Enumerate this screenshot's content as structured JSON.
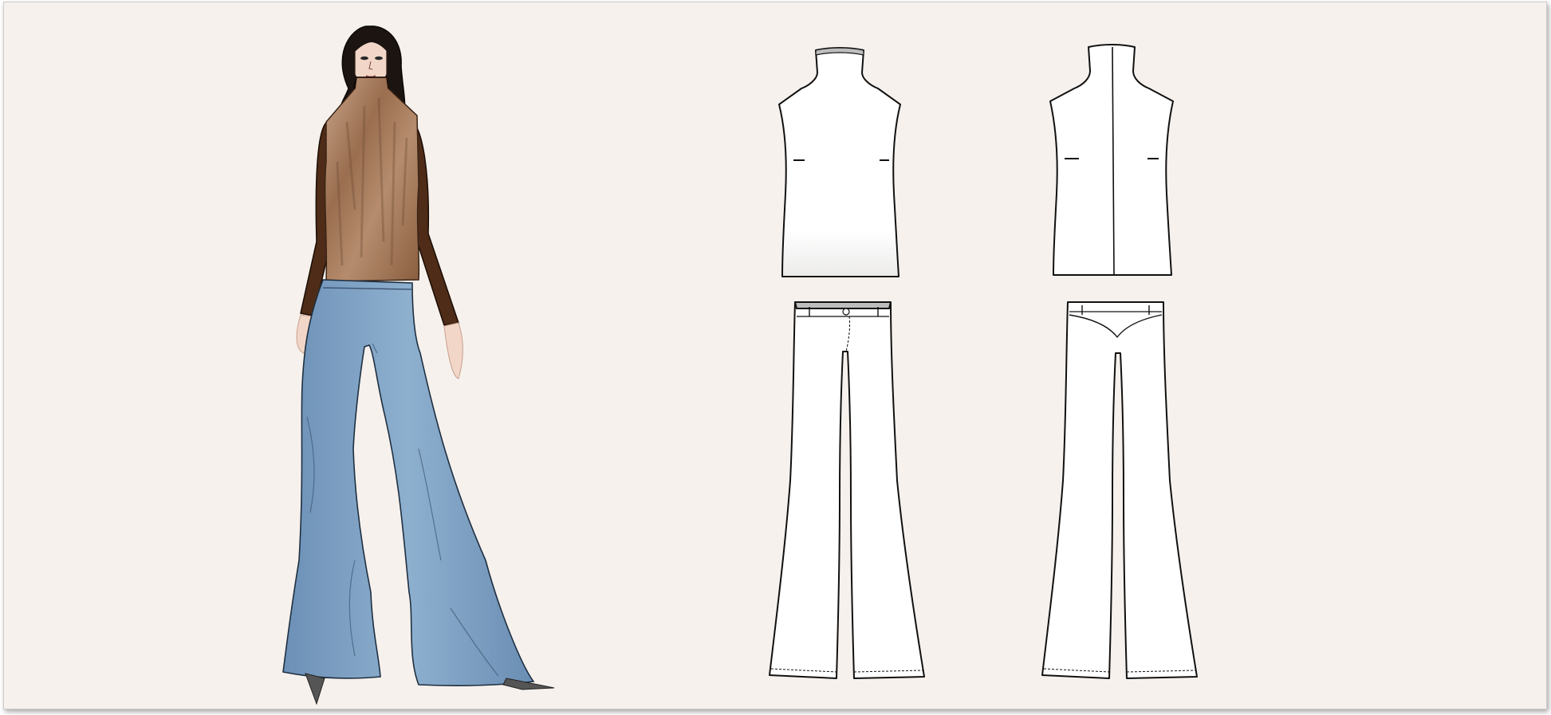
{
  "artboard": {
    "background_color": "#f6f1ed",
    "border_color": "#cfcbc8"
  },
  "illustration": {
    "subject": "fashion-figure",
    "top_color": "#a5795a",
    "sleeve_color": "#4e2c17",
    "hair_color": "#1c1411",
    "skin_color": "#f2d6c7",
    "denim_color": "#7c9fc2",
    "shoe_color": "#555555"
  },
  "flats": {
    "line_color": "#111111",
    "fill_color": "#ffffff",
    "items": [
      {
        "icon": "turtleneck-front-icon"
      },
      {
        "icon": "turtleneck-back-icon"
      },
      {
        "icon": "flare-pants-front-icon"
      },
      {
        "icon": "flare-pants-back-icon"
      }
    ]
  }
}
